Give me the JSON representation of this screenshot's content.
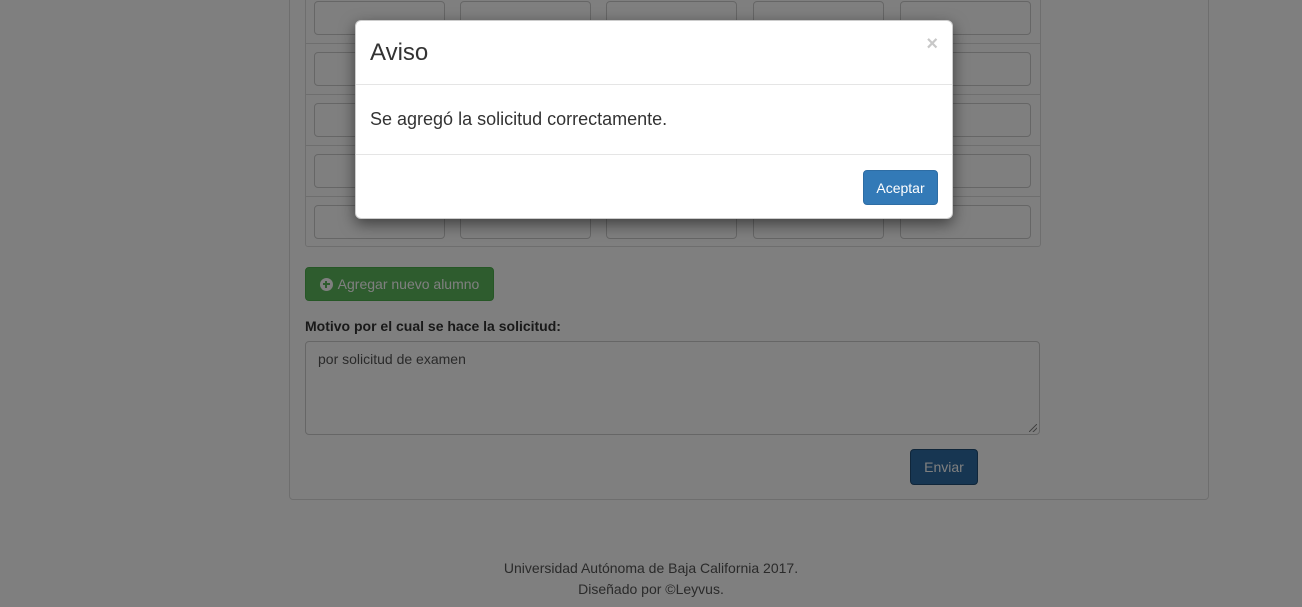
{
  "page": {
    "add_student_label": "Agregar nuevo alumno",
    "reason_label": "Motivo por el cual se hace la solicitud:",
    "reason_value": "por solicitud de examen",
    "send_label": "Enviar",
    "footer_line1": "Universidad Autónoma de Baja California 2017.",
    "footer_line2": "Diseñado por ©Leyvus."
  },
  "modal": {
    "title": "Aviso",
    "close_symbol": "×",
    "message": "Se agregó la solicitud correctamente.",
    "accept_label": "Aceptar"
  },
  "colors": {
    "success": "#5cb85c",
    "primary": "#337ab7",
    "primary_dark": "#2e6da4"
  }
}
